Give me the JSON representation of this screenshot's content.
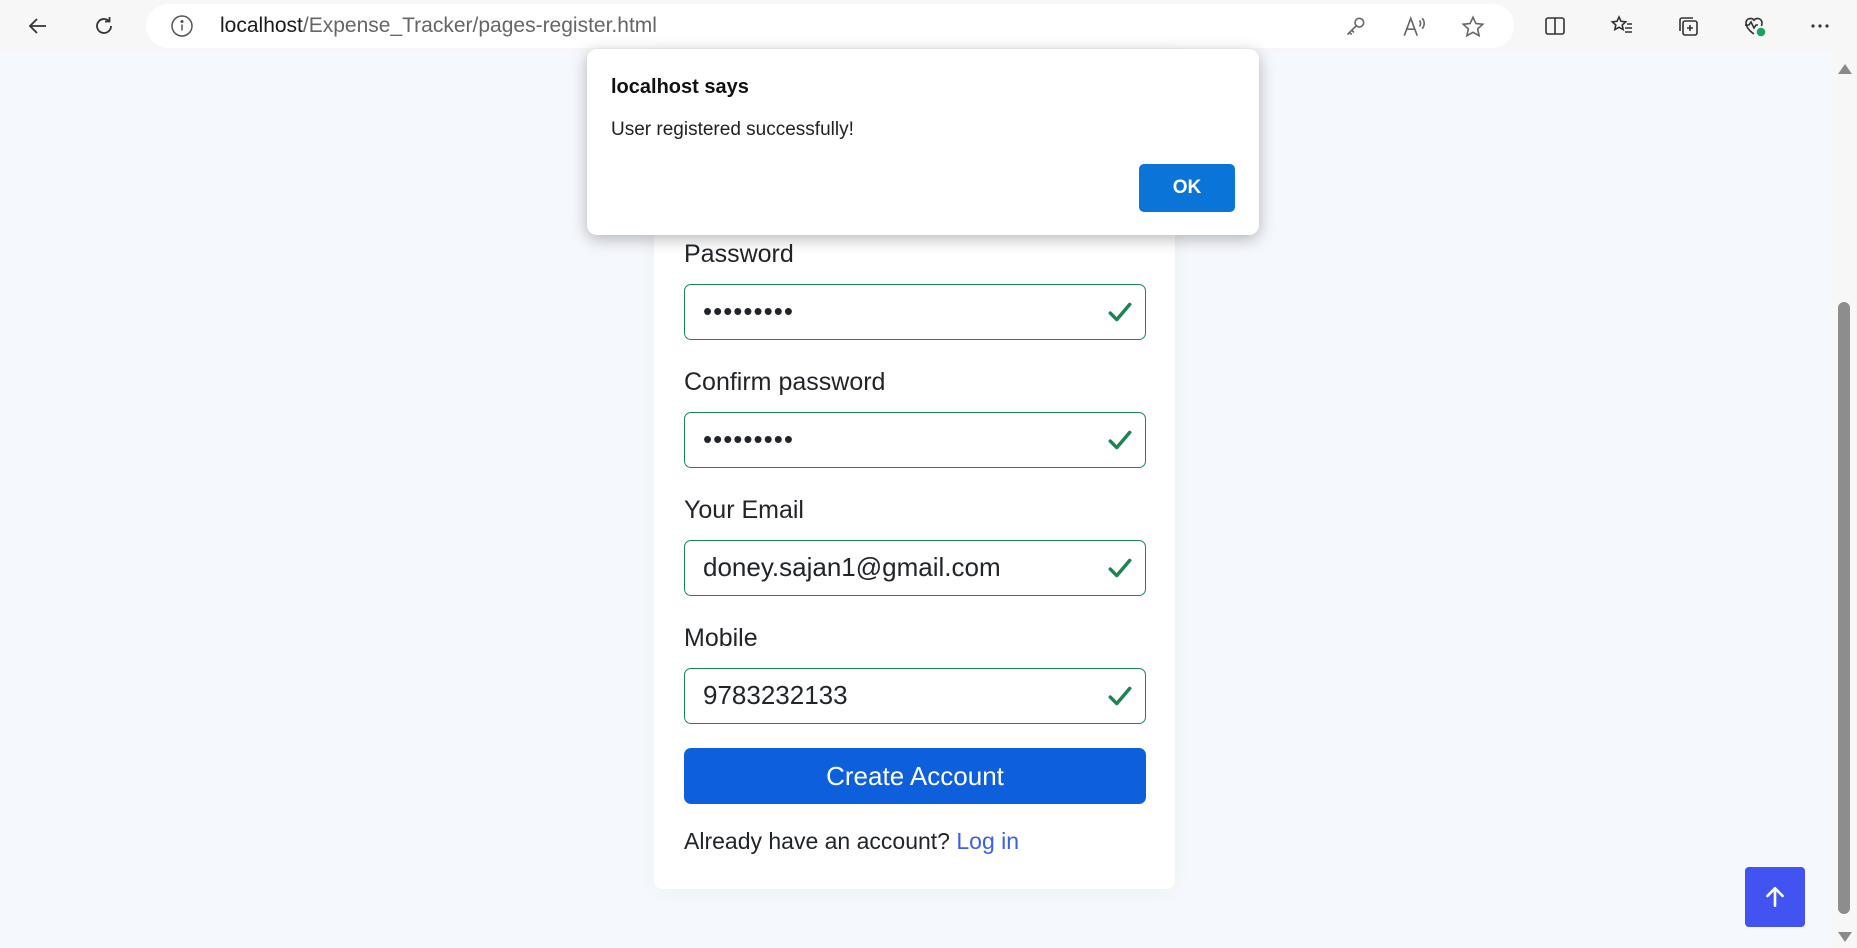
{
  "browser": {
    "url_host": "localhost",
    "url_path": "/Expense_Tracker/pages-register.html",
    "icons": {
      "back": "back-arrow-icon",
      "refresh": "refresh-icon",
      "info": "info-icon",
      "key": "key-icon",
      "read_aloud": "read-aloud-icon",
      "favorite": "star-icon",
      "split": "split-screen-icon",
      "favorites": "favorites-icon",
      "collections": "collections-icon",
      "health": "browser-essentials-icon",
      "more": "more-icon"
    }
  },
  "form": {
    "password": {
      "label": "Password",
      "value": "•••••••••"
    },
    "confirm_password": {
      "label": "Confirm password",
      "value": "•••••••••"
    },
    "email": {
      "label": "Your Email",
      "value": "doney.sajan1@gmail.com"
    },
    "mobile": {
      "label": "Mobile",
      "value": "9783232133"
    },
    "submit_label": "Create Account",
    "login_prompt": "Already have an account?",
    "login_link": "Log in"
  },
  "dialog": {
    "title": "localhost says",
    "message": "User registered successfully!",
    "ok_label": "OK"
  },
  "colors": {
    "valid_border": "#198754",
    "primary_button": "#0d5fdc",
    "link": "#3d5ee5",
    "back_to_top": "#4154f1",
    "dialog_ok": "#0a74d8"
  }
}
